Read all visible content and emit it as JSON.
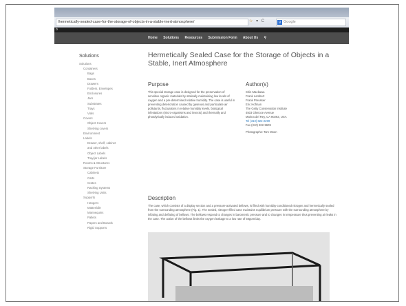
{
  "browser": {
    "url": "/hermetically-sealed-case-for-the-storage-of-objects-in-a-stable-inert-atmosphere/",
    "search_engine": "Google",
    "url_icons": [
      "star-icon",
      "dropdown-icon",
      "reload-icon"
    ]
  },
  "topbar": {
    "text": "b"
  },
  "nav": {
    "items": [
      "Home",
      "Solutions",
      "Resources",
      "Submission Form",
      "About Us"
    ],
    "search_icon": "search-icon"
  },
  "sidebar": {
    "heading": "Solutions",
    "items": [
      {
        "label": "Solutions",
        "level": 1
      },
      {
        "label": "Containers",
        "level": 2
      },
      {
        "label": "Bags",
        "level": 3
      },
      {
        "label": "Boxes",
        "level": 3
      },
      {
        "label": "Drawers",
        "level": 3
      },
      {
        "label": "Folders, Envelopes",
        "level": 3
      },
      {
        "label": "Enclosures",
        "level": 3
      },
      {
        "label": "Jars",
        "level": 3
      },
      {
        "label": "Substrates",
        "level": 3
      },
      {
        "label": "Trays",
        "level": 3
      },
      {
        "label": "Vials",
        "level": 3
      },
      {
        "label": "Covers",
        "level": 2
      },
      {
        "label": "Object Covers",
        "level": 3
      },
      {
        "label": "Shelving covers",
        "level": 3
      },
      {
        "label": "Environment",
        "level": 2
      },
      {
        "label": "Labels",
        "level": 2
      },
      {
        "label": "Drawer, shelf, cabinet",
        "level": 3
      },
      {
        "label": "and other labels",
        "level": 3
      },
      {
        "label": "Object Labels",
        "level": 3
      },
      {
        "label": "Tray/jar Labels",
        "level": 3
      },
      {
        "label": "Rooms & Structures",
        "level": 2
      },
      {
        "label": "Storage Furniture",
        "level": 2
      },
      {
        "label": "Cabinets",
        "level": 3
      },
      {
        "label": "Carts",
        "level": 3
      },
      {
        "label": "Crates",
        "level": 3
      },
      {
        "label": "Racking Systems",
        "level": 3
      },
      {
        "label": "Shelving Units",
        "level": 3
      },
      {
        "label": "Supports",
        "level": 2
      },
      {
        "label": "Hangers",
        "level": 3
      },
      {
        "label": "Mattes/die",
        "level": 3
      },
      {
        "label": "Mannequins",
        "level": 3
      },
      {
        "label": "Pallets",
        "level": 3
      },
      {
        "label": "Papers and Boards",
        "level": 3
      },
      {
        "label": "Rigid Supports",
        "level": 3
      }
    ]
  },
  "main": {
    "title": "Hermetically Sealed Case for the Storage of Objects in a Stable, Inert Atmosphere",
    "purpose_heading": "Purpose",
    "purpose_text": "This special storage case is designed for the preservation of sensitive organic materials by statically maintaining low levels of oxygen and a pre-determined relative humidity. The case is useful in preventing deterioration caused by gaseous and particulate air pollutants, fluctuations in relative humidity levels, biological infestations (micro-organisms and insects) and thermally and photolytically induced oxidation.",
    "authors_heading": "Author(s)",
    "authors": [
      "Shin Maekawa",
      "Frank Lambert",
      "Frank Preusser",
      "Eric Hofman",
      "The Getty Conservation Institute",
      "4503 Glencoe Avenue",
      "Marina del Rey, CA 90292, USA",
      "Tel (310) 822-2299",
      "Fax (310) 822-9609"
    ],
    "photographer": "Photographs: Tom Moon",
    "description_heading": "Description",
    "description_text": "The case, which consists of a display section and a pressure-activated bellows, is filled with humidity-conditioned nitrogen and hermetically sealed from the surrounding atmosphere (Fig. 1). The sealed, nitrogen-filled case maintains equilibrium pressure with the surrounding atmosphere by inflating and deflating of bellows. The bellows respond to changes in barometric pressure and to changes in temperature thus preventing air leaks in the case. The action of the bellows limits the oxygen leakage to a low rate of 50ppm/day."
  }
}
